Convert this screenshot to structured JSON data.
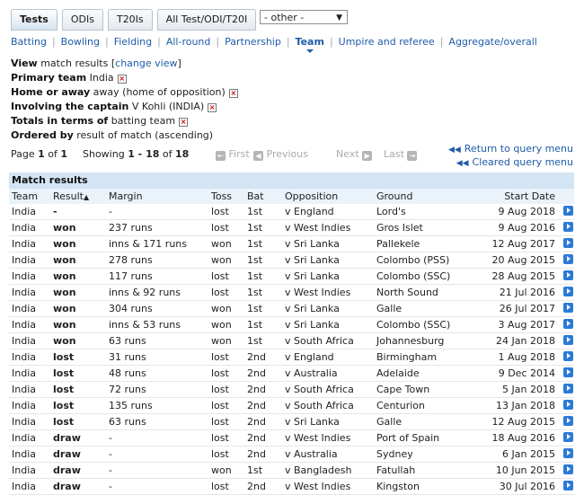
{
  "tabs": [
    {
      "label": "Tests",
      "active": true
    },
    {
      "label": "ODIs",
      "active": false
    },
    {
      "label": "T20Is",
      "active": false
    },
    {
      "label": "All Test/ODI/T20I",
      "active": false
    }
  ],
  "format_select": {
    "value": "- other -"
  },
  "subnav": [
    "Batting",
    "Bowling",
    "Fielding",
    "All-round",
    "Partnership",
    "Team",
    "Umpire and referee",
    "Aggregate/overall"
  ],
  "subnav_active": "Team",
  "query": {
    "view_label": "View",
    "view_value": "match results",
    "change_view": "change view",
    "primary_team_label": "Primary team",
    "primary_team_value": "India",
    "home_away_label": "Home or away",
    "home_away_value": "away (home of opposition)",
    "captain_label": "Involving the captain",
    "captain_value": "V Kohli (INDIA)",
    "totals_label": "Totals in terms of",
    "totals_value": "batting team",
    "ordered_label": "Ordered by",
    "ordered_value": "result of match (ascending)"
  },
  "pager": {
    "page_text_1": "Page",
    "page": "1",
    "page_of": "of",
    "page_total": "1",
    "showing_label": "Showing",
    "range": "1 - 18",
    "of_label": "of",
    "total": "18",
    "first": "First",
    "previous": "Previous",
    "next": "Next",
    "last": "Last"
  },
  "query_links": {
    "return": "Return to query menu",
    "cleared": "Cleared query menu"
  },
  "results": {
    "heading": "Match results",
    "columns": [
      "Team",
      "Result",
      "Margin",
      "Toss",
      "Bat",
      "Opposition",
      "Ground",
      "Start Date"
    ],
    "rows": [
      [
        "India",
        "-",
        "-",
        "lost",
        "1st",
        "v England",
        "Lord's",
        "9 Aug 2018"
      ],
      [
        "India",
        "won",
        "237 runs",
        "lost",
        "1st",
        "v West Indies",
        "Gros Islet",
        "9 Aug 2016"
      ],
      [
        "India",
        "won",
        "inns & 171 runs",
        "won",
        "1st",
        "v Sri Lanka",
        "Pallekele",
        "12 Aug 2017"
      ],
      [
        "India",
        "won",
        "278 runs",
        "won",
        "1st",
        "v Sri Lanka",
        "Colombo (PSS)",
        "20 Aug 2015"
      ],
      [
        "India",
        "won",
        "117 runs",
        "lost",
        "1st",
        "v Sri Lanka",
        "Colombo (SSC)",
        "28 Aug 2015"
      ],
      [
        "India",
        "won",
        "inns & 92 runs",
        "lost",
        "1st",
        "v West Indies",
        "North Sound",
        "21 Jul 2016"
      ],
      [
        "India",
        "won",
        "304 runs",
        "won",
        "1st",
        "v Sri Lanka",
        "Galle",
        "26 Jul 2017"
      ],
      [
        "India",
        "won",
        "inns & 53 runs",
        "won",
        "1st",
        "v Sri Lanka",
        "Colombo (SSC)",
        "3 Aug 2017"
      ],
      [
        "India",
        "won",
        "63 runs",
        "won",
        "1st",
        "v South Africa",
        "Johannesburg",
        "24 Jan 2018"
      ],
      [
        "India",
        "lost",
        "31 runs",
        "lost",
        "2nd",
        "v England",
        "Birmingham",
        "1 Aug 2018"
      ],
      [
        "India",
        "lost",
        "48 runs",
        "lost",
        "2nd",
        "v Australia",
        "Adelaide",
        "9 Dec 2014"
      ],
      [
        "India",
        "lost",
        "72 runs",
        "lost",
        "2nd",
        "v South Africa",
        "Cape Town",
        "5 Jan 2018"
      ],
      [
        "India",
        "lost",
        "135 runs",
        "lost",
        "2nd",
        "v South Africa",
        "Centurion",
        "13 Jan 2018"
      ],
      [
        "India",
        "lost",
        "63 runs",
        "lost",
        "2nd",
        "v Sri Lanka",
        "Galle",
        "12 Aug 2015"
      ],
      [
        "India",
        "draw",
        "-",
        "lost",
        "2nd",
        "v West Indies",
        "Port of Spain",
        "18 Aug 2016"
      ],
      [
        "India",
        "draw",
        "-",
        "lost",
        "2nd",
        "v Australia",
        "Sydney",
        "6 Jan 2015"
      ],
      [
        "India",
        "draw",
        "-",
        "won",
        "1st",
        "v Bangladesh",
        "Fatullah",
        "10 Jun 2015"
      ],
      [
        "India",
        "draw",
        "-",
        "lost",
        "2nd",
        "v West Indies",
        "Kingston",
        "30 Jul 2016"
      ]
    ]
  },
  "colors": {
    "link": "#1f5ba8",
    "header_band": "#d3e4f4",
    "column_header": "#eaf2fa",
    "go_icon": "#2c7ad6"
  }
}
